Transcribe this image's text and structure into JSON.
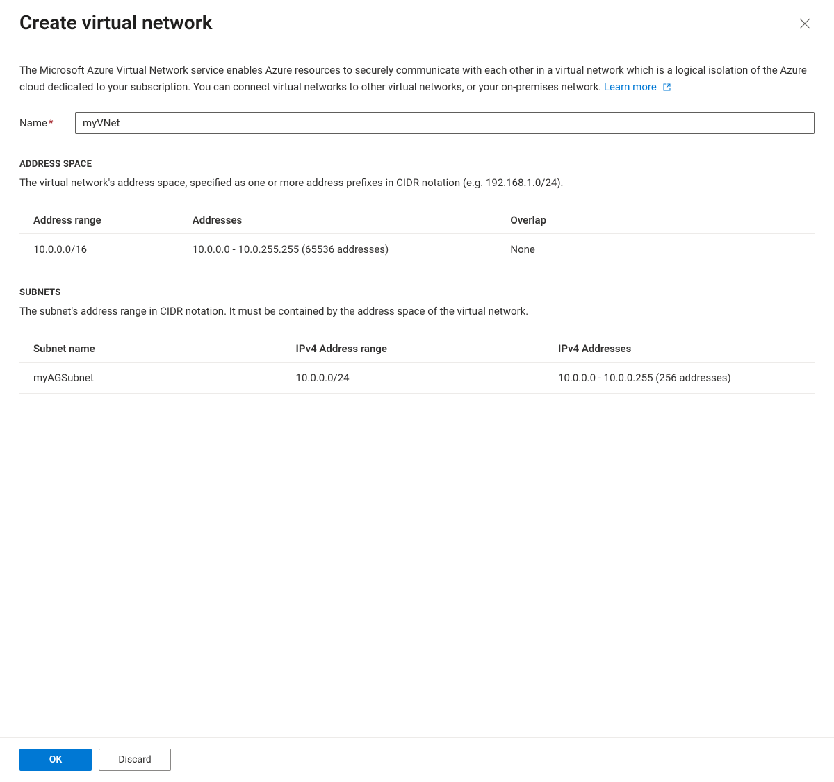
{
  "header": {
    "title": "Create virtual network"
  },
  "intro": {
    "text": "The Microsoft Azure Virtual Network service enables Azure resources to securely communicate with each other in a virtual network which is a logical isolation of the Azure cloud dedicated to your subscription. You can connect virtual networks to other virtual networks, or your on-premises network.  ",
    "learn_more": "Learn more"
  },
  "name_field": {
    "label": "Name",
    "value": "myVNet"
  },
  "address_space": {
    "heading": "ADDRESS SPACE",
    "desc": "The virtual network's address space, specified as one or more address prefixes in CIDR notation (e.g. 192.168.1.0/24).",
    "columns": {
      "range": "Address range",
      "addresses": "Addresses",
      "overlap": "Overlap"
    },
    "rows": [
      {
        "range": "10.0.0.0/16",
        "addresses": "10.0.0.0 - 10.0.255.255 (65536 addresses)",
        "overlap": "None"
      }
    ]
  },
  "subnets": {
    "heading": "SUBNETS",
    "desc": "The subnet's address range in CIDR notation. It must be contained by the address space of the virtual network.",
    "columns": {
      "name": "Subnet name",
      "range": "IPv4 Address range",
      "addresses": "IPv4 Addresses"
    },
    "rows": [
      {
        "name": "myAGSubnet",
        "range": "10.0.0.0/24",
        "addresses": "10.0.0.0 - 10.0.0.255 (256 addresses)"
      }
    ]
  },
  "footer": {
    "ok": "OK",
    "discard": "Discard"
  }
}
